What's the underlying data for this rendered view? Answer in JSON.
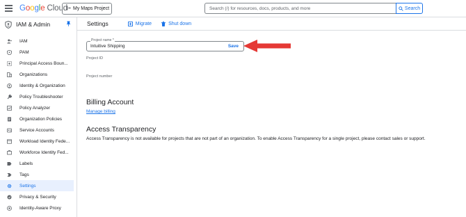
{
  "topbar": {
    "logo_letters": [
      "G",
      "o",
      "o",
      "g",
      "l",
      "e"
    ],
    "logo_cloud": "Cloud",
    "project_label": "My Maps Project",
    "search_placeholder": "Search (/) for resources, docs, products, and more",
    "search_button": "Search"
  },
  "sidebar": {
    "title": "IAM & Admin",
    "items": [
      {
        "label": "IAM",
        "icon": "person-add-icon"
      },
      {
        "label": "PAM",
        "icon": "shield-key-icon"
      },
      {
        "label": "Principal Access Boun...",
        "icon": "boundary-icon"
      },
      {
        "label": "Organizations",
        "icon": "building-icon"
      },
      {
        "label": "Identity & Organization",
        "icon": "identity-icon"
      },
      {
        "label": "Policy Troubleshooter",
        "icon": "wrench-icon"
      },
      {
        "label": "Policy Analyzer",
        "icon": "analyzer-icon"
      },
      {
        "label": "Organization Policies",
        "icon": "policy-doc-icon"
      },
      {
        "label": "Service Accounts",
        "icon": "service-account-icon"
      },
      {
        "label": "Workload Identity Fede...",
        "icon": "workload-icon"
      },
      {
        "label": "Workforce Identity Fed...",
        "icon": "workforce-icon"
      },
      {
        "label": "Labels",
        "icon": "label-icon"
      },
      {
        "label": "Tags",
        "icon": "tag-icon"
      },
      {
        "label": "Settings",
        "icon": "gear-icon"
      },
      {
        "label": "Privacy & Security",
        "icon": "privacy-icon"
      },
      {
        "label": "Identity-Aware Proxy",
        "icon": "proxy-icon"
      }
    ],
    "active_label": "Settings"
  },
  "main": {
    "title": "Settings",
    "migrate_label": "Migrate",
    "shutdown_label": "Shut down",
    "project_name_label": "Project name *",
    "project_name_value": "Intuitive Shipping",
    "save_label": "Save",
    "project_id_label": "Project ID",
    "project_number_label": "Project number",
    "billing_heading": "Billing Account",
    "manage_billing_link": "Manage billing",
    "access_heading": "Access Transparency",
    "access_text": "Access Transparency is not available for projects that are not part of an organization. To enable Access Transparency for a single project, please contact sales or support."
  },
  "colors": {
    "accent": "#1a73e8",
    "arrow": "#e53935",
    "active_bg": "#e8f0fe"
  }
}
